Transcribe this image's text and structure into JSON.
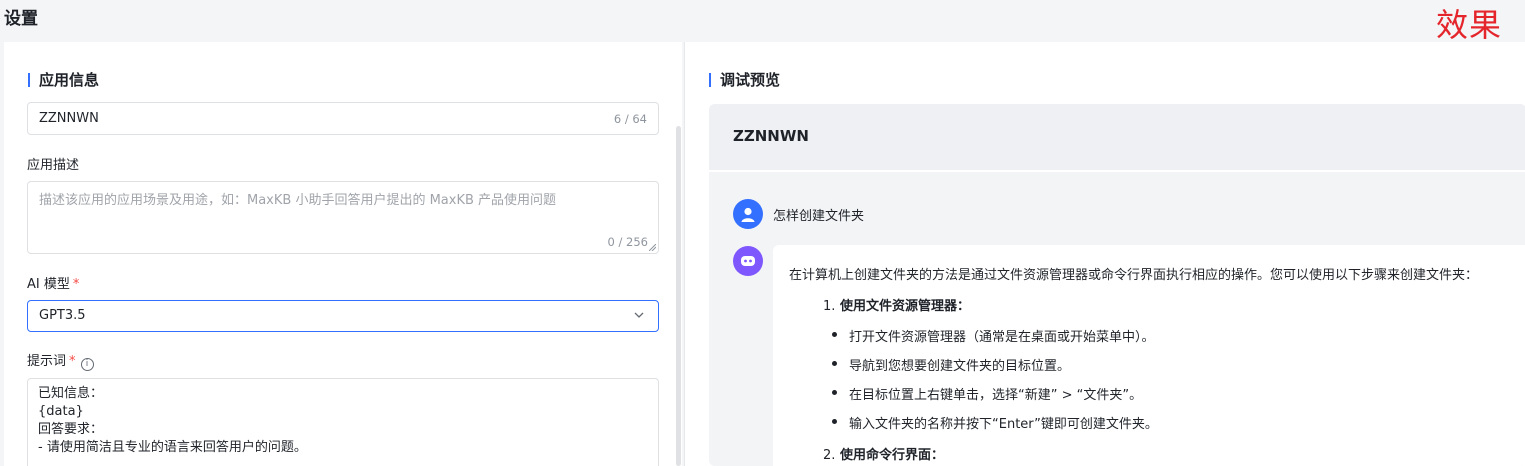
{
  "page": {
    "title": "设置",
    "watermark": "效果"
  },
  "app_info": {
    "section_title": "应用信息",
    "name_value": "ZZNNWN",
    "name_counter": "6 / 64",
    "desc_label": "应用描述",
    "desc_placeholder": "描述该应用的应用场景及用途，如：MaxKB 小助手回答用户提出的 MaxKB 产品使用问题",
    "desc_counter": "0 / 256",
    "model_label": "AI 模型",
    "model_required": "*",
    "model_value": "GPT3.5",
    "prompt_label": "提示词",
    "prompt_required": "*",
    "prompt_lines": [
      "已知信息：",
      "{data}",
      "回答要求：",
      "- 请使用简洁且专业的语言来回答用户的问题。"
    ]
  },
  "preview": {
    "section_title": "调试预览",
    "app_name": "ZZNNWN",
    "question": "怎样创建文件夹",
    "answer": {
      "intro": "在计算机上创建文件夹的方法是通过文件资源管理器或命令行界面执行相应的操作。您可以使用以下步骤来创建文件夹：",
      "steps": [
        {
          "num": "1.",
          "title": "使用文件资源管理器：",
          "bullets": [
            "打开文件资源管理器（通常是在桌面或开始菜单中）。",
            "导航到您想要创建文件夹的目标位置。",
            "在目标位置上右键单击，选择“新建” > “文件夹”。",
            "输入文件夹的名称并按下“Enter”键即可创建文件夹。"
          ]
        },
        {
          "num": "2.",
          "title": "使用命令行界面："
        }
      ]
    }
  },
  "colors": {
    "accent": "#3370ff",
    "required": "#f54a45",
    "watermark": "#e4262c",
    "bot_avatar": "#7f57ff"
  },
  "icons": {
    "select": "chevron-down-icon",
    "prompt_info": "info-icon",
    "user": "user-avatar-icon",
    "bot": "bot-avatar-icon"
  }
}
